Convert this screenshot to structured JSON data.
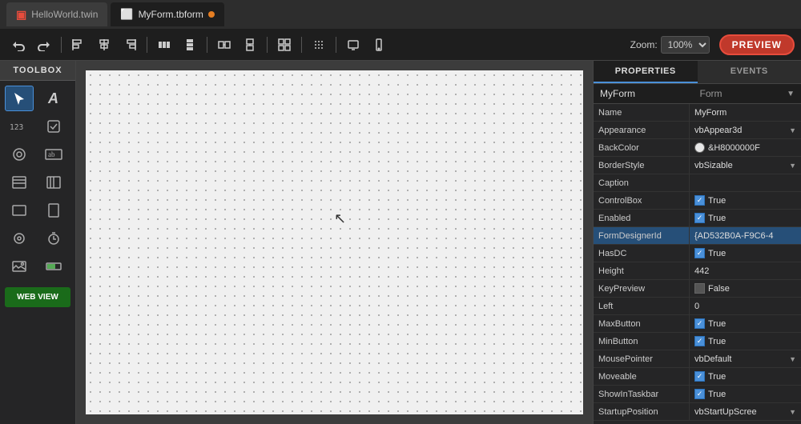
{
  "titleBar": {
    "tabs": [
      {
        "id": "helloworld",
        "label": "HelloWorld.twin",
        "icon": "twin",
        "active": false
      },
      {
        "id": "myform",
        "label": "MyForm.tbform",
        "icon": "tbform",
        "active": true,
        "modified": true
      }
    ]
  },
  "toolbar": {
    "undo_label": "↩",
    "redo_label": "↪",
    "zoom_label": "Zoom:",
    "zoom_value": "100%",
    "preview_label": "PREVIEW"
  },
  "toolbox": {
    "header": "TOOLBOX",
    "tools": [
      {
        "id": "pointer",
        "label": "▲",
        "selected": true
      },
      {
        "id": "text",
        "label": "A",
        "text": true
      },
      {
        "id": "numeric",
        "label": "123"
      },
      {
        "id": "checkbox",
        "label": "☑"
      },
      {
        "id": "gear",
        "label": "⚙"
      },
      {
        "id": "textbox",
        "label": "ab"
      },
      {
        "id": "hlist",
        "label": "▤"
      },
      {
        "id": "vlist",
        "label": "▥"
      },
      {
        "id": "hframe",
        "label": "▭"
      },
      {
        "id": "vframe",
        "label": "▯"
      },
      {
        "id": "circle",
        "label": "◎"
      },
      {
        "id": "clock",
        "label": "🕐"
      },
      {
        "id": "image",
        "label": "🖼"
      },
      {
        "id": "progress",
        "label": "▓"
      }
    ],
    "webview_label": "WEB\nVIEW"
  },
  "canvas": {
    "background": "#f0f0f0"
  },
  "properties": {
    "tabs": [
      {
        "id": "properties",
        "label": "PROPERTIES",
        "active": true
      },
      {
        "id": "events",
        "label": "EVENTS",
        "active": false
      }
    ],
    "selector": {
      "name": "MyForm",
      "type": "Form"
    },
    "rows": [
      {
        "name": "Name",
        "value": "MyForm",
        "type": "text"
      },
      {
        "name": "Appearance",
        "value": "vbAppear3d",
        "type": "dropdown"
      },
      {
        "name": "BackColor",
        "value": "&H8000000F",
        "type": "color",
        "color": "#f0f0f0"
      },
      {
        "name": "BorderStyle",
        "value": "vbSizable",
        "type": "dropdown"
      },
      {
        "name": "Caption",
        "value": "",
        "type": "text"
      },
      {
        "name": "ControlBox",
        "value": "True",
        "type": "checkbox",
        "checked": true
      },
      {
        "name": "Enabled",
        "value": "True",
        "type": "checkbox",
        "checked": true
      },
      {
        "name": "FormDesignerId",
        "value": "{AD532B0A-F9C6-4",
        "type": "text"
      },
      {
        "name": "HasDC",
        "value": "True",
        "type": "checkbox",
        "checked": true
      },
      {
        "name": "Height",
        "value": "442",
        "type": "text"
      },
      {
        "name": "KeyPreview",
        "value": "False",
        "type": "checkbox",
        "checked": false
      },
      {
        "name": "Left",
        "value": "0",
        "type": "text"
      },
      {
        "name": "MaxButton",
        "value": "True",
        "type": "checkbox",
        "checked": true
      },
      {
        "name": "MinButton",
        "value": "True",
        "type": "checkbox",
        "checked": true
      },
      {
        "name": "MousePointer",
        "value": "vbDefault",
        "type": "dropdown"
      },
      {
        "name": "Moveable",
        "value": "True",
        "type": "checkbox",
        "checked": true
      },
      {
        "name": "ShowInTaskbar",
        "value": "True",
        "type": "checkbox",
        "checked": true
      },
      {
        "name": "StartupPosition",
        "value": "vbStartUpScree",
        "type": "dropdown"
      }
    ]
  }
}
